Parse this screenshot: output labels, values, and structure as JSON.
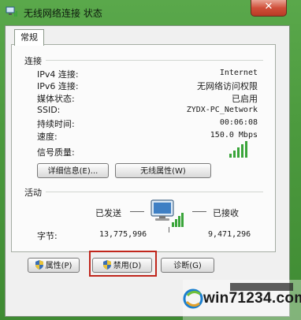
{
  "window": {
    "title": "无线网络连接 状态",
    "close_label": "✕"
  },
  "tabs": [
    {
      "label": "常规"
    }
  ],
  "connection": {
    "section_label": "连接",
    "rows": [
      {
        "label": "IPv4 连接:",
        "value": "Internet"
      },
      {
        "label": "IPv6 连接:",
        "value": "无网络访问权限"
      },
      {
        "label": "媒体状态:",
        "value": "已启用"
      },
      {
        "label": "SSID:",
        "value": "ZYDX-PC_Network"
      },
      {
        "label": "持续时间:",
        "value": "00:06:08"
      },
      {
        "label": "速度:",
        "value": "150.0 Mbps"
      }
    ],
    "signal_label": "信号质量:",
    "signal_bars_active": 5,
    "details_button": "详细信息(E)...",
    "wireless_props_button": "无线属性(W)"
  },
  "activity": {
    "section_label": "活动",
    "sent_label": "已发送",
    "received_label": "已接收",
    "bytes_label": "字节:",
    "bytes_sent": "13,775,996",
    "bytes_received": "9,471,296"
  },
  "bottom_buttons": {
    "properties": "属性(P)",
    "disable": "禁用(D)",
    "diagnose": "诊断(G)"
  },
  "watermark": {
    "text": "win71234.com"
  },
  "colors": {
    "highlight_border": "#c0261c",
    "signal_green": "#3aa53a",
    "titlebar_green": "#4c9a3e"
  }
}
